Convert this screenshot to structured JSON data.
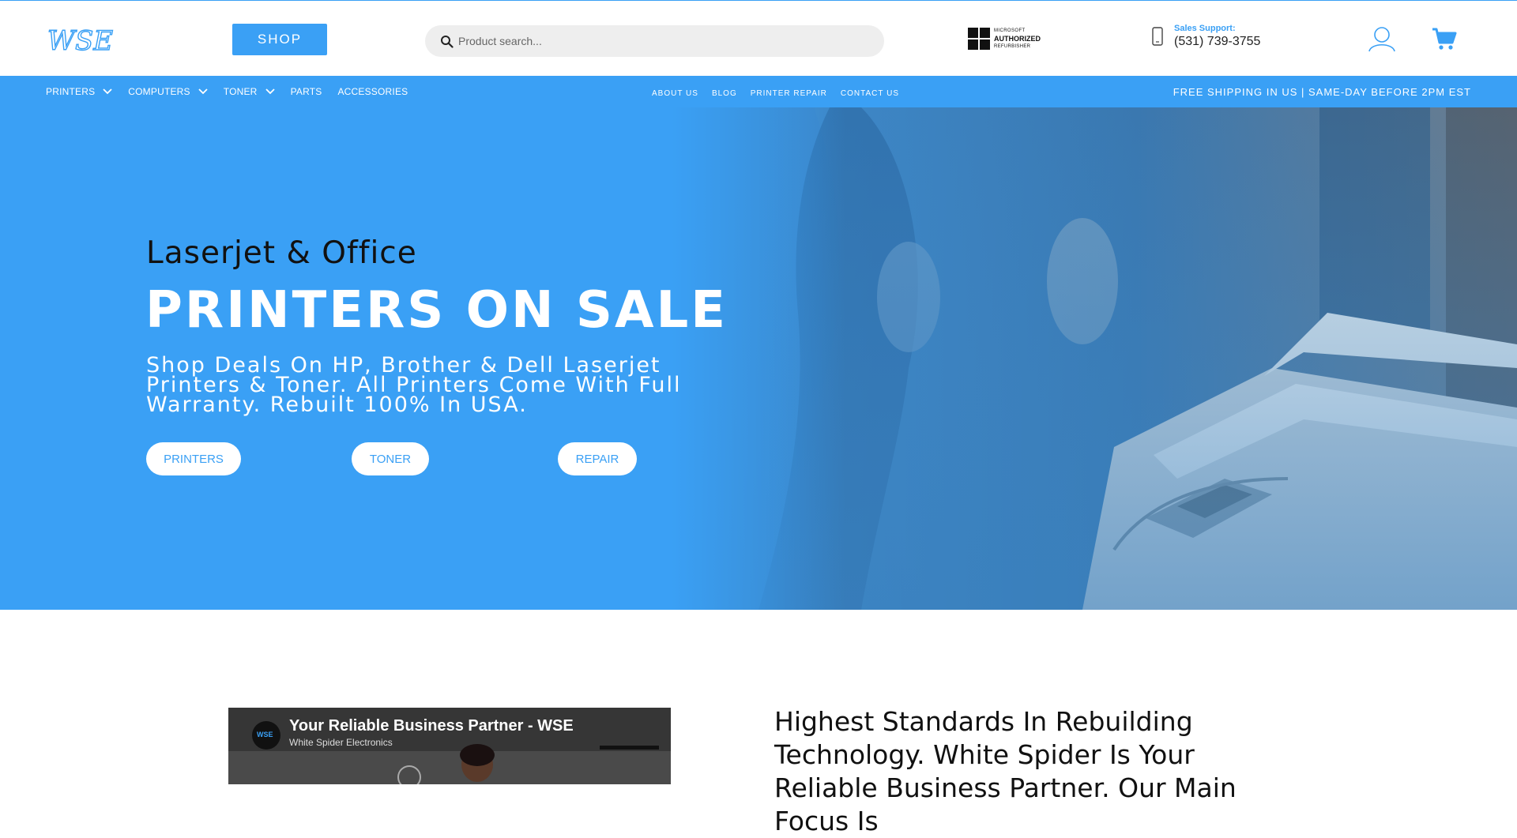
{
  "header": {
    "logo_text": "WSE",
    "shop_label": "SHOP",
    "search_placeholder": "Product search...",
    "badge": {
      "line1": "MICROSOFT",
      "line2": "AUTHORIZED",
      "line3": "REFURBISHER"
    },
    "support_label": "Sales Support:",
    "support_phone": "(531) 739-3755"
  },
  "nav": {
    "left_items": [
      {
        "label": "PRINTERS",
        "has_dropdown": true
      },
      {
        "label": "COMPUTERS",
        "has_dropdown": true
      },
      {
        "label": "TONER",
        "has_dropdown": true
      },
      {
        "label": "PARTS",
        "has_dropdown": false
      },
      {
        "label": "ACCESSORIES",
        "has_dropdown": false
      }
    ],
    "center_links": [
      "ABOUT US",
      "BLOG",
      "PRINTER REPAIR",
      "CONTACT US"
    ],
    "shipping_notice": "FREE SHIPPING IN US | SAME-DAY BEFORE 2PM EST"
  },
  "hero": {
    "subtitle": "Laserjet & Office",
    "title": "PRINTERS ON SALE",
    "description": "Shop Deals On HP, Brother & Dell Laserjet Printers & Toner. All Printers Come With Full Warranty. Rebuilt 100% In USA.",
    "buttons": [
      "PRINTERS",
      "TONER",
      "REPAIR"
    ]
  },
  "video": {
    "channel_logo": "WSE",
    "title": "Your Reliable Business Partner - WSE",
    "channel": "White Spider Electronics"
  },
  "about": {
    "text": "Highest Standards In Rebuilding Technology. White Spider Is Your Reliable Business Partner. Our Main Focus Is"
  },
  "colors": {
    "accent": "#3aa0f5",
    "text": "#111111"
  }
}
